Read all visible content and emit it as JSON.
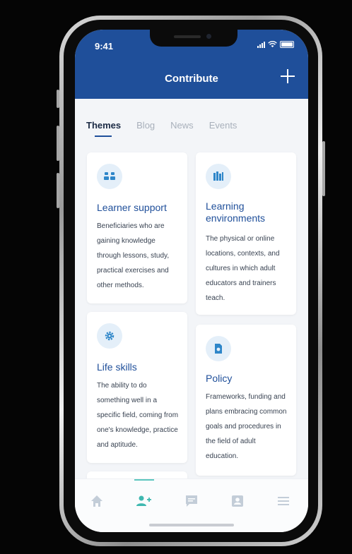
{
  "status_bar": {
    "time": "9:41"
  },
  "header": {
    "title": "Contribute",
    "add_icon": "plus-icon"
  },
  "tabs": [
    {
      "label": "Themes",
      "active": true
    },
    {
      "label": "Blog",
      "active": false
    },
    {
      "label": "News",
      "active": false
    },
    {
      "label": "Events",
      "active": false
    }
  ],
  "cards": [
    {
      "title": "Learner support",
      "description": "Beneficiaries who are gaining knowledge through lessons, study, practical exercises and other methods.",
      "icon": "people-icon"
    },
    {
      "title": "Learning environments",
      "description": "The physical or online locations, contexts, and cultures in which adult educators and trainers teach.",
      "icon": "books-icon"
    },
    {
      "title": "Life skills",
      "description": "The ability to do something well in a specific field, coming from one's knowledge, practice and aptitude.",
      "icon": "gear-icon"
    },
    {
      "title": "Policy",
      "description": "Frameworks, funding and plans embracing common goals and procedures in the field of adult education.",
      "icon": "document-icon"
    }
  ],
  "bottom_nav": [
    {
      "icon": "home-icon",
      "active": false
    },
    {
      "icon": "add-user-icon",
      "active": true
    },
    {
      "icon": "message-icon",
      "active": false
    },
    {
      "icon": "profile-icon",
      "active": false
    },
    {
      "icon": "menu-icon",
      "active": false
    }
  ],
  "colors": {
    "brand_blue": "#1f4f9a",
    "accent_teal": "#5cc6bf",
    "icon_circle": "#e4eff9",
    "background": "#f3f5f8"
  }
}
